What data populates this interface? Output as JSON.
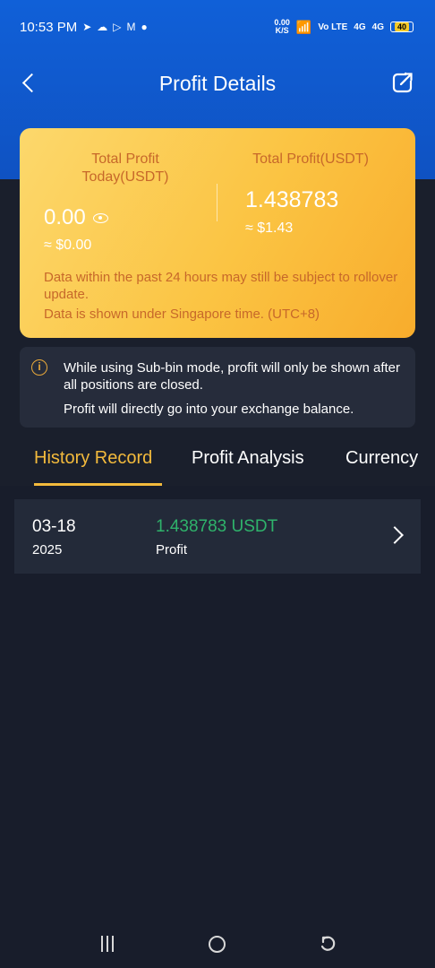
{
  "status_bar": {
    "time": "10:53 PM",
    "notif_icons": [
      "telegram-icon",
      "chat-icon",
      "play-icon",
      "gmail-icon",
      "dot-icon"
    ],
    "speed_value": "0.00",
    "speed_unit": "K/S",
    "volte": "Vo LTE",
    "network1": "4G",
    "network2": "4G",
    "battery": "40"
  },
  "header": {
    "title": "Profit Details"
  },
  "profit_card": {
    "today_label": "Total Profit Today(USDT)",
    "today_value": "0.00",
    "today_usd": "≈ $0.00",
    "total_label": "Total Profit(USDT)",
    "total_value": "1.438783",
    "total_usd": "≈ $1.43",
    "note_1": "Data within the past 24 hours may still be subject to rollover update.",
    "note_2": "Data is shown under Singapore time. (UTC+8)"
  },
  "info": {
    "line_1": "While using Sub-bin mode, profit will only be shown after all positions are closed.",
    "line_2": "Profit will directly go into your exchange balance."
  },
  "tabs": [
    {
      "label": "History Record",
      "active": true
    },
    {
      "label": "Profit Analysis",
      "active": false
    },
    {
      "label": "Currency",
      "active": false
    }
  ],
  "records": [
    {
      "date": "03-18",
      "year": "2025",
      "amount": "1.438783 USDT",
      "type": "Profit"
    }
  ],
  "colors": {
    "accent": "#f3ba3c",
    "profit_green": "#2fb36b",
    "header_blue": "#1060d8"
  }
}
